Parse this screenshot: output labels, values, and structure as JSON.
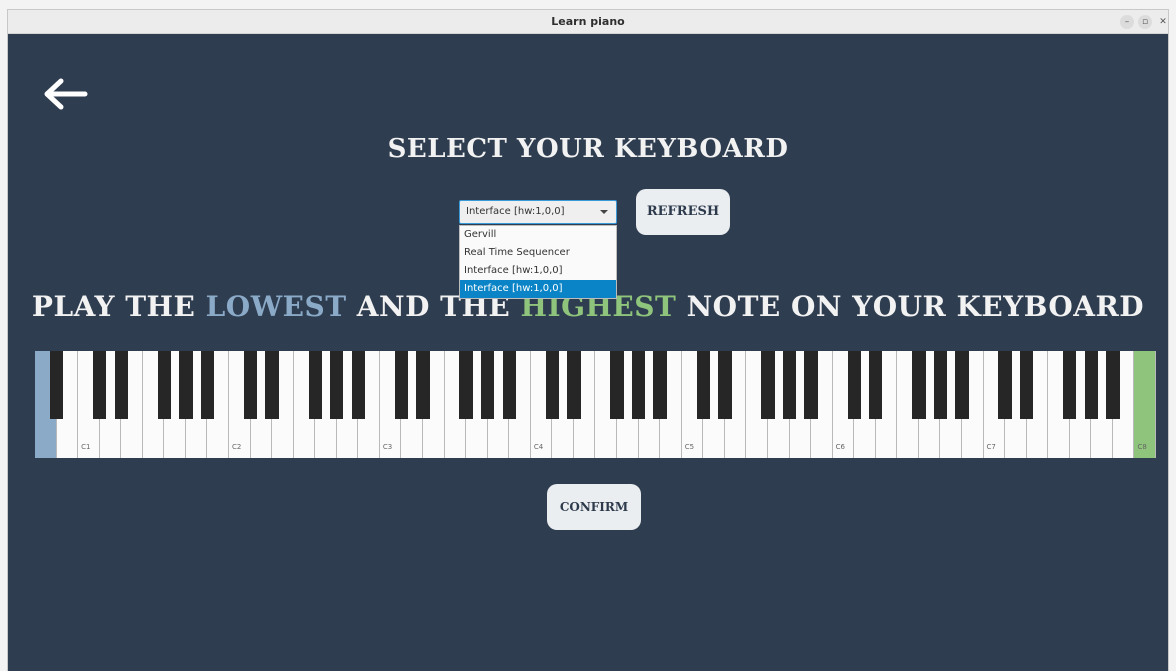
{
  "window": {
    "title": "Learn piano"
  },
  "headings": {
    "select": "SELECT YOUR KEYBOARD",
    "play_prefix": "PLAY THE ",
    "play_low": "LOWEST",
    "play_mid": " AND THE ",
    "play_high": "HIGHEST",
    "play_suffix": " NOTE ON YOUR KEYBOARD"
  },
  "device_select": {
    "value": "Interface [hw:1,0,0]",
    "options": [
      "Gervill",
      "Real Time Sequencer",
      "Interface [hw:1,0,0]",
      "Interface [hw:1,0,0]"
    ],
    "selected_index": 3
  },
  "buttons": {
    "refresh": "REFRESH",
    "confirm": "CONFIRM"
  },
  "keyboard": {
    "white_key_count": 52,
    "lowest_key_index": 0,
    "highest_key_index": 51,
    "octave_labels": [
      "C1",
      "C2",
      "C3",
      "C4",
      "C5",
      "C6",
      "C7",
      "C8"
    ]
  },
  "colors": {
    "background": "#2f3d50",
    "lowest": "#8aaac8",
    "highest": "#8fc47c",
    "dropdown_selected": "#0a84c6"
  }
}
